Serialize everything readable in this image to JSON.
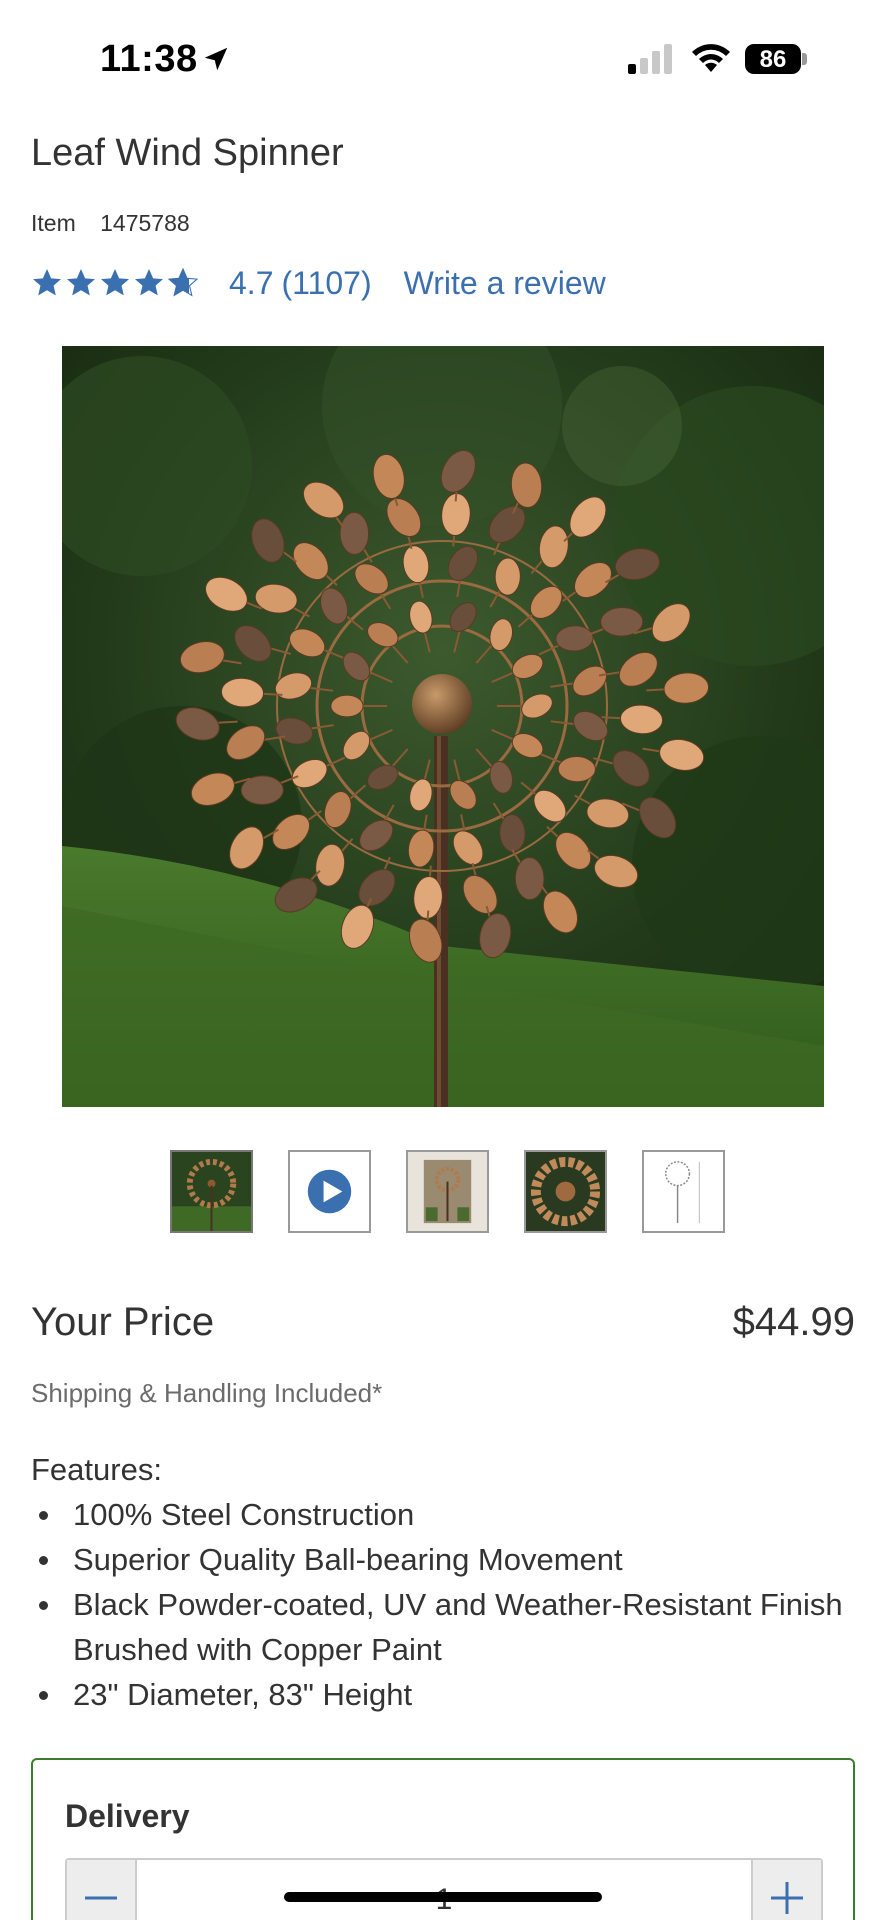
{
  "status_bar": {
    "time": "11:38",
    "battery": "86",
    "icons": [
      "location-arrow-icon",
      "cellular-signal-icon",
      "wifi-icon",
      "battery-icon"
    ]
  },
  "product": {
    "title": "Leaf Wind Spinner",
    "item_label": "Item",
    "item_number": "1475788",
    "rating": {
      "stars": 4.7,
      "value_text": "4.7",
      "count_text": "(1107)",
      "write_review": "Write a review"
    }
  },
  "gallery": {
    "main_image": "leaf-wind-spinner-photo",
    "thumbnails": [
      {
        "name": "thumbnail-spinner-garden",
        "active": true
      },
      {
        "name": "thumbnail-video",
        "icon": "play-icon"
      },
      {
        "name": "thumbnail-spinner-porch"
      },
      {
        "name": "thumbnail-spinner-closeup"
      },
      {
        "name": "thumbnail-spinner-dimensions"
      }
    ]
  },
  "pricing": {
    "label": "Your Price",
    "value": "$44.99",
    "shipping_note": "Shipping & Handling Included*"
  },
  "features": {
    "heading": "Features:",
    "items": [
      "100% Steel Construction",
      "Superior Quality Ball-bearing Movement",
      "Black Powder-coated, UV and Weather-Resistant Finish Brushed with Copper Paint",
      "23\" Diameter, 83\" Height"
    ]
  },
  "delivery": {
    "title": "Delivery",
    "quantity": "1"
  },
  "colors": {
    "link_blue": "#3a6fb0",
    "delivery_border_green": "#3a7d2c",
    "text_dark": "#333333",
    "text_muted": "#6b6b6b"
  }
}
